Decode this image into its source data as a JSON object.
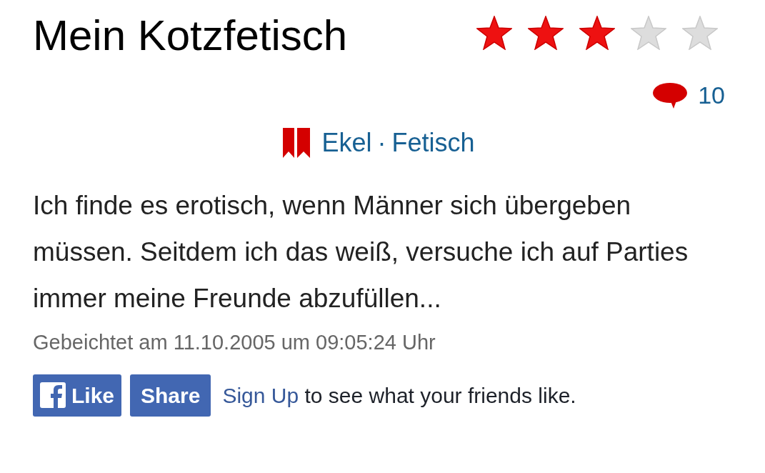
{
  "title": "Mein Kotzfetisch",
  "rating": {
    "stars": 3
  },
  "comments": "10",
  "tags": [
    "Ekel",
    "Fetisch"
  ],
  "tag_separator": "·",
  "body": "Ich finde es erotisch, wenn Männer sich übergeben müssen. Seitdem ich das weiß, versuche ich auf Parties immer meine Freunde abzufüllen...",
  "meta": "Gebeichtet am 11.10.2005 um 09:05:24 Uhr",
  "facebook": {
    "like": "Like",
    "share": "Share",
    "signup_link": "Sign Up",
    "signup_text": " to see what your friends like."
  }
}
